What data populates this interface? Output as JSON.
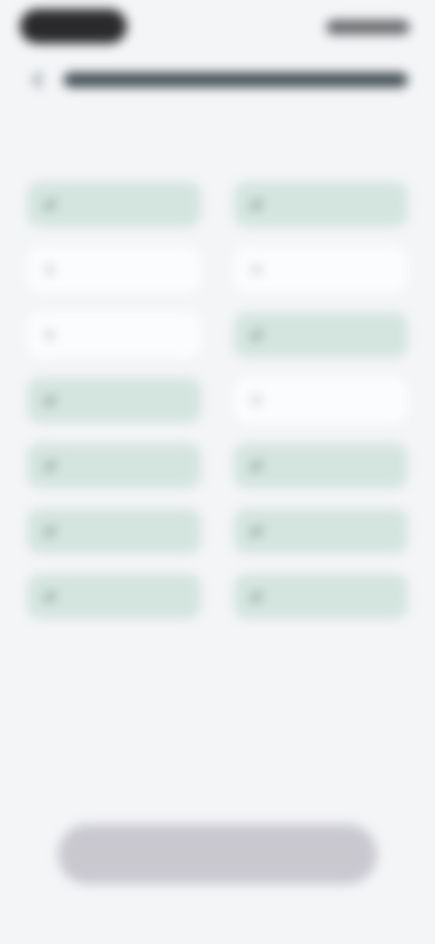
{
  "progress": {
    "fraction": 1.0
  },
  "colors": {
    "selected_chip": "#d4e4df",
    "unselected_chip": "#fbfcfd",
    "button_disabled": "#c9c8cf",
    "background": "#f4f5f7"
  },
  "chips": [
    {
      "selected": true,
      "icon": "check-icon"
    },
    {
      "selected": true,
      "icon": "check-icon"
    },
    {
      "selected": false,
      "icon": "plus-icon"
    },
    {
      "selected": false,
      "icon": "plus-icon"
    },
    {
      "selected": false,
      "icon": "plus-icon"
    },
    {
      "selected": true,
      "icon": "check-icon"
    },
    {
      "selected": true,
      "icon": "check-icon"
    },
    {
      "selected": false,
      "icon": "plus-icon"
    },
    {
      "selected": true,
      "icon": "check-icon"
    },
    {
      "selected": true,
      "icon": "check-icon"
    },
    {
      "selected": true,
      "icon": "check-icon"
    },
    {
      "selected": true,
      "icon": "check-icon"
    },
    {
      "selected": true,
      "icon": "check-icon"
    },
    {
      "selected": true,
      "icon": "check-icon"
    }
  ]
}
